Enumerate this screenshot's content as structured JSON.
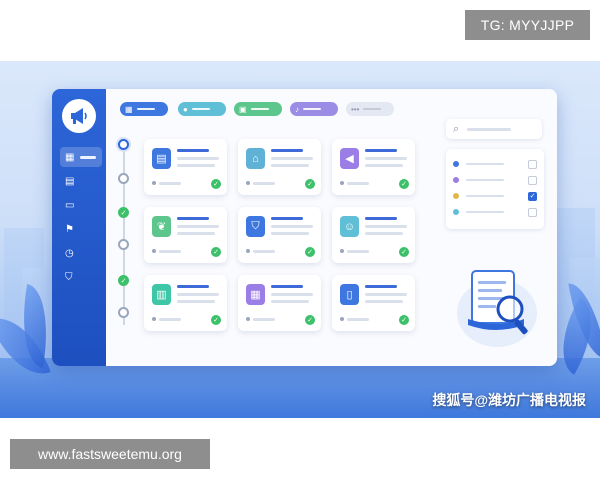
{
  "overlay": {
    "top_right_badge": "TG: MYYJJPP",
    "bottom_left_badge": "www.fastsweetemu.org",
    "watermark": "搜狐号@潍坊广播电视报"
  },
  "colors": {
    "primary_blue": "#2d66d8",
    "success_green": "#3cc06a",
    "chip_blue": "#3f77e0",
    "chip_teal": "#5fbfd6",
    "chip_green": "#5cc68c",
    "chip_purple": "#9b8de6"
  },
  "sidebar": {
    "logo_icon": "megaphone-icon",
    "items": [
      {
        "icon": "grid-icon",
        "active": true
      },
      {
        "icon": "document-icon",
        "active": false
      },
      {
        "icon": "folder-icon",
        "active": false
      },
      {
        "icon": "flag-icon",
        "active": false
      },
      {
        "icon": "clock-icon",
        "active": false
      },
      {
        "icon": "shield-icon",
        "active": false
      }
    ]
  },
  "chips": [
    {
      "icon": "grid-icon",
      "color": "#3f77e0"
    },
    {
      "icon": "user-icon",
      "color": "#5fbfd6"
    },
    {
      "icon": "image-icon",
      "color": "#5cc68c"
    },
    {
      "icon": "bell-icon",
      "color": "#9b8de6"
    },
    {
      "icon": "more-icon",
      "color": "#e3e8f2"
    }
  ],
  "cards": [
    {
      "icon": "document-icon",
      "color": "#3f77e0",
      "status": "done"
    },
    {
      "icon": "building-icon",
      "color": "#5fb2d6",
      "status": "done"
    },
    {
      "icon": "megaphone-icon",
      "color": "#9b7de6",
      "status": "done"
    },
    {
      "icon": "leaf-icon",
      "color": "#5cc68c",
      "status": "done"
    },
    {
      "icon": "shield-check-icon",
      "color": "#3f77e0",
      "status": "done"
    },
    {
      "icon": "person-card-icon",
      "color": "#5fbfd6",
      "status": "done"
    },
    {
      "icon": "bar-chart-icon",
      "color": "#3fc6a6",
      "status": "done"
    },
    {
      "icon": "clipboard-icon",
      "color": "#9b7de6",
      "status": "done"
    },
    {
      "icon": "book-icon",
      "color": "#3f77e0",
      "status": "done"
    }
  ],
  "right_panel": {
    "search_icon": "search-icon",
    "filters": [
      {
        "color": "#3f77e0",
        "checked": false
      },
      {
        "color": "#9b7de6",
        "checked": false
      },
      {
        "color": "#e0b84a",
        "checked": true
      },
      {
        "color": "#5fbfd6",
        "checked": false
      }
    ],
    "illustration_icon": "magnifier-document-icon"
  }
}
